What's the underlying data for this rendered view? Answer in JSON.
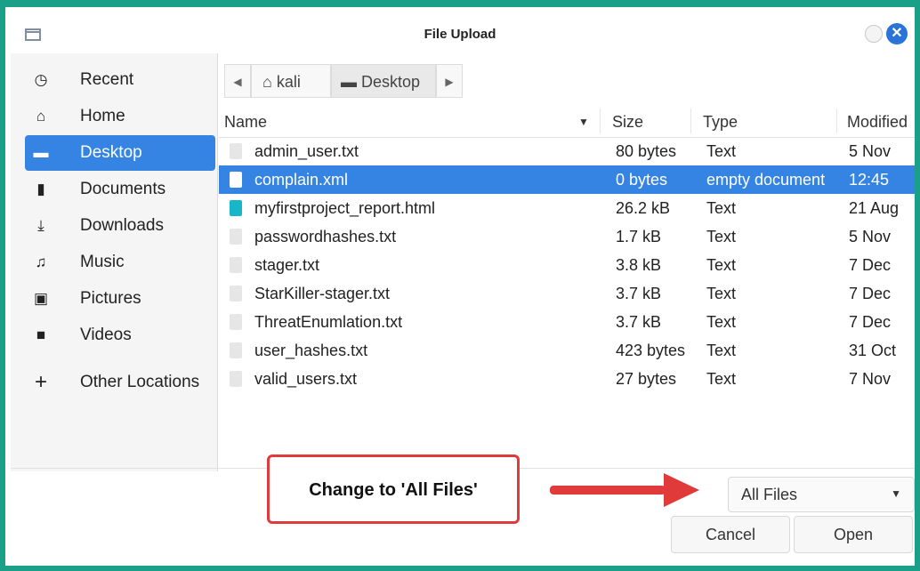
{
  "window": {
    "title": "File Upload"
  },
  "sidebar": {
    "items": [
      {
        "label": "Recent",
        "icon": "clock-icon"
      },
      {
        "label": "Home",
        "icon": "home-icon"
      },
      {
        "label": "Desktop",
        "icon": "desktop-icon",
        "active": true
      },
      {
        "label": "Documents",
        "icon": "document-icon"
      },
      {
        "label": "Downloads",
        "icon": "download-icon"
      },
      {
        "label": "Music",
        "icon": "music-icon"
      },
      {
        "label": "Pictures",
        "icon": "pictures-icon"
      },
      {
        "label": "Videos",
        "icon": "video-icon"
      },
      {
        "label": "Other Locations",
        "icon": "plus-icon"
      }
    ]
  },
  "pathbar": {
    "crumbs": [
      "kali",
      "Desktop"
    ]
  },
  "columns": {
    "name": "Name",
    "size": "Size",
    "type": "Type",
    "modified": "Modified"
  },
  "files": [
    {
      "name": "admin_user.txt",
      "size": "80 bytes",
      "type": "Text",
      "modified": "5 Nov"
    },
    {
      "name": "complain.xml",
      "size": "0 bytes",
      "type": "empty document",
      "modified": "12:45",
      "selected": true
    },
    {
      "name": "myfirstproject_report.html",
      "size": "26.2 kB",
      "type": "Text",
      "modified": "21 Aug"
    },
    {
      "name": "passwordhashes.txt",
      "size": "1.7 kB",
      "type": "Text",
      "modified": "5 Nov"
    },
    {
      "name": "stager.txt",
      "size": "3.8 kB",
      "type": "Text",
      "modified": "7 Dec"
    },
    {
      "name": "StarKiller-stager.txt",
      "size": "3.7 kB",
      "type": "Text",
      "modified": "7 Dec"
    },
    {
      "name": "ThreatEnumlation.txt",
      "size": "3.7 kB",
      "type": "Text",
      "modified": "7 Dec"
    },
    {
      "name": "user_hashes.txt",
      "size": "423 bytes",
      "type": "Text",
      "modified": "31 Oct"
    },
    {
      "name": "valid_users.txt",
      "size": "27 bytes",
      "type": "Text",
      "modified": "7 Nov"
    }
  ],
  "annotation": {
    "text": "Change to 'All Files'"
  },
  "filter": {
    "selected": "All Files"
  },
  "buttons": {
    "cancel": "Cancel",
    "open": "Open"
  },
  "colors": {
    "accent": "#3584e4",
    "annotation": "#e03a3a",
    "border": "#1aa088"
  }
}
